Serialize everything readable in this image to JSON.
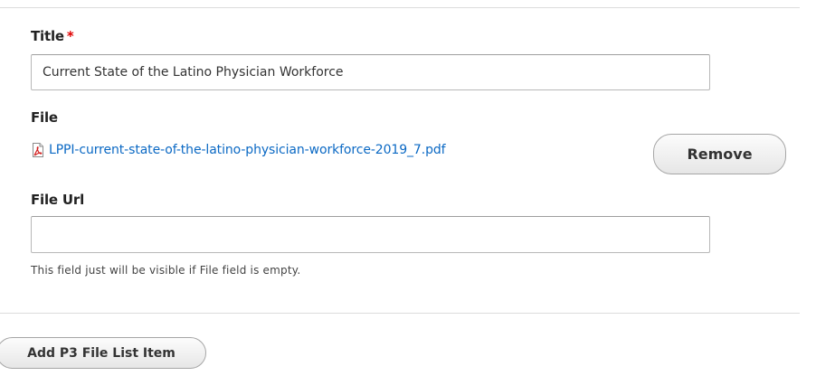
{
  "title_field": {
    "label": "Title",
    "required_marker": "*",
    "value": "Current State of the Latino Physician Workforce"
  },
  "file_field": {
    "label": "File",
    "file_icon": "pdf-file-icon",
    "file_name": "LPPI-current-state-of-the-latino-physician-workforce-2019_7.pdf",
    "remove_label": "Remove"
  },
  "file_url_field": {
    "label": "File Url",
    "value": "",
    "help_text": "This field just will be visible if File field is empty."
  },
  "add_item_label": "Add P3 File List Item",
  "colors": {
    "required": "#e00000",
    "link": "#0b69c4"
  }
}
